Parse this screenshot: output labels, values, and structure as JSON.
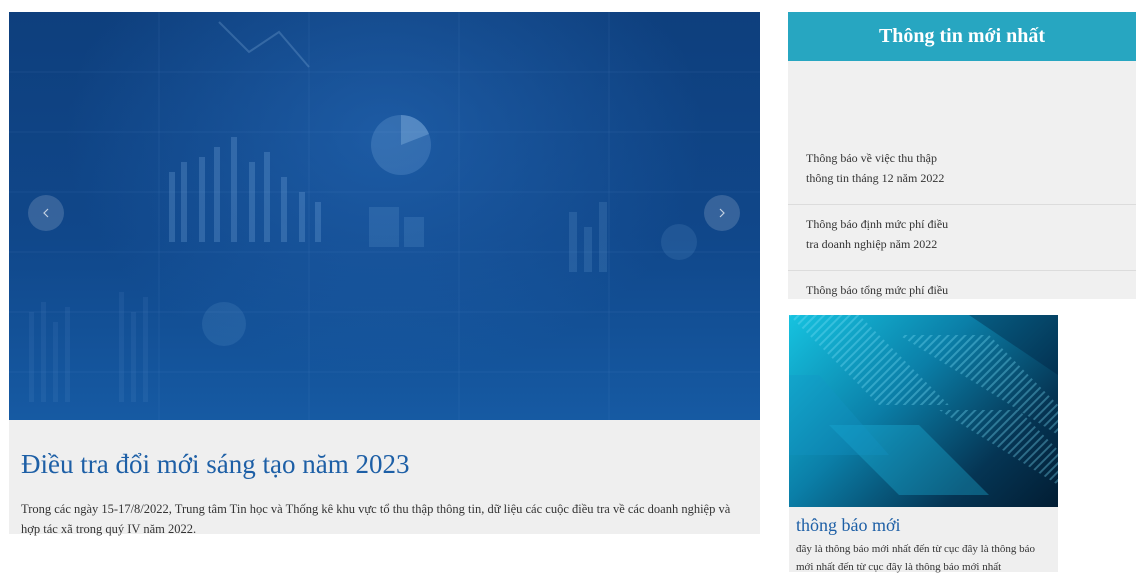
{
  "slider": {
    "title": "Điều tra đổi mới sáng tạo năm 2023",
    "description": "Trong các ngày 15-17/8/2022, Trung tâm Tin học và Thống kê khu vực tổ thu thập thông tin, dữ liệu các cuộc điều tra về các doanh nghiệp và hợp tác xã trong quý IV năm 2022.",
    "prev_icon": "chevron-left-icon",
    "next_icon": "chevron-right-icon"
  },
  "news": {
    "header": "Thông tin mới nhất",
    "items": [
      {
        "label": "Thông báo về việc thu thập thông tin tháng 12 năm 2022"
      },
      {
        "label": "Thông báo định mức phí điều tra doanh nghiệp năm 2022"
      },
      {
        "label": "Thông báo tổng mức phí điều"
      }
    ]
  },
  "card": {
    "title": "thông báo mới",
    "text": "đây là thông báo mới nhất đến từ cục đây là thông báo mới nhất đến từ cục đây là thông báo mới nhất"
  },
  "colors": {
    "accent": "#27a6c1",
    "link": "#1d5fa6",
    "slider_bg": "#10478a"
  }
}
